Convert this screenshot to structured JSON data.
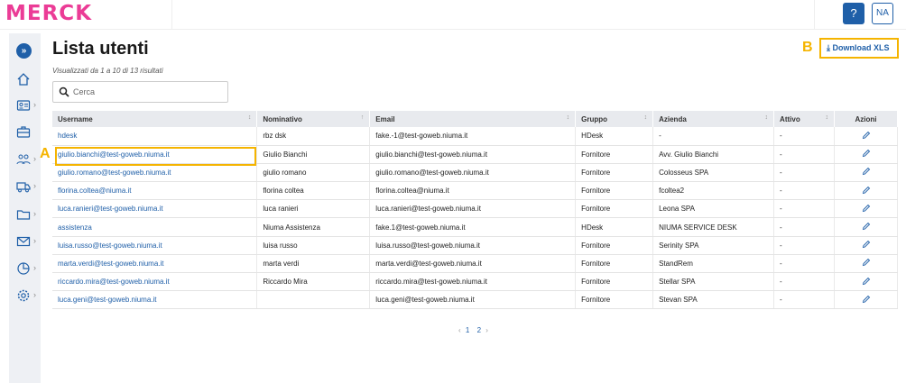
{
  "header": {
    "logo_text": "MERCK",
    "help_label": "?",
    "avatar_initials": "NA",
    "brand_color": "#eb3c96",
    "accent_color": "#1f5fa8"
  },
  "sidebar": {
    "expand_icon": "double-chevron-right-icon",
    "items": [
      {
        "name": "home",
        "icon": "home-icon",
        "has_submenu": false
      },
      {
        "name": "contacts",
        "icon": "id-card-icon",
        "has_submenu": true
      },
      {
        "name": "briefcase",
        "icon": "briefcase-icon",
        "has_submenu": false
      },
      {
        "name": "users",
        "icon": "users-icon",
        "has_submenu": true
      },
      {
        "name": "transport",
        "icon": "truck-icon",
        "has_submenu": true
      },
      {
        "name": "folder",
        "icon": "folder-icon",
        "has_submenu": true
      },
      {
        "name": "mail",
        "icon": "mail-icon",
        "has_submenu": true
      },
      {
        "name": "reports",
        "icon": "pie-chart-icon",
        "has_submenu": true
      },
      {
        "name": "settings",
        "icon": "gear-icon",
        "has_submenu": true
      }
    ]
  },
  "page": {
    "title": "Lista utenti",
    "subtitle": "Visualizzati da 1 a 10 di 13 risultati",
    "download_label": "Download XLS",
    "search_placeholder": "Cerca",
    "annotation_a": "A",
    "annotation_b": "B"
  },
  "table": {
    "columns": [
      "Username",
      "Nominativo",
      "Email",
      "Gruppo",
      "Azienda",
      "Attivo",
      "Azioni"
    ],
    "rows": [
      {
        "username": "hdesk",
        "nominativo": "rbz dsk",
        "email": "fake.-1@test-goweb.niuma.it",
        "gruppo": "HDesk",
        "azienda": "-",
        "attivo": "-"
      },
      {
        "username": "giulio.bianchi@test-goweb.niuma.it",
        "nominativo": "Giulio Bianchi",
        "email": "giulio.bianchi@test-goweb.niuma.it",
        "gruppo": "Fornitore",
        "azienda": "Avv. Giulio Bianchi",
        "attivo": "-"
      },
      {
        "username": "giulio.romano@test-goweb.niuma.it",
        "nominativo": "giulio romano",
        "email": "giulio.romano@test-goweb.niuma.it",
        "gruppo": "Fornitore",
        "azienda": "Colosseus SPA",
        "attivo": "-"
      },
      {
        "username": "florina.coltea@niuma.it",
        "nominativo": "florina coltea",
        "email": "florina.coltea@niuma.it",
        "gruppo": "Fornitore",
        "azienda": "fcoltea2",
        "attivo": "-"
      },
      {
        "username": "luca.ranieri@test-goweb.niuma.it",
        "nominativo": "luca ranieri",
        "email": "luca.ranieri@test-goweb.niuma.it",
        "gruppo": "Fornitore",
        "azienda": "Leona SPA",
        "attivo": "-"
      },
      {
        "username": "assistenza",
        "nominativo": "Niuma Assistenza",
        "email": "fake.1@test-goweb.niuma.it",
        "gruppo": "HDesk",
        "azienda": "NIUMA SERVICE DESK",
        "attivo": "-"
      },
      {
        "username": "luisa.russo@test-goweb.niuma.it",
        "nominativo": "luisa russo",
        "email": "luisa.russo@test-goweb.niuma.it",
        "gruppo": "Fornitore",
        "azienda": "Serinity SPA",
        "attivo": "-"
      },
      {
        "username": "marta.verdi@test-goweb.niuma.it",
        "nominativo": "marta verdi",
        "email": "marta.verdi@test-goweb.niuma.it",
        "gruppo": "Fornitore",
        "azienda": "StandRem",
        "attivo": "-"
      },
      {
        "username": "riccardo.mira@test-goweb.niuma.it",
        "nominativo": "Riccardo Mira",
        "email": "riccardo.mira@test-goweb.niuma.it",
        "gruppo": "Fornitore",
        "azienda": "Stellar SPA",
        "attivo": "-"
      },
      {
        "username": "luca.geni@test-goweb.niuma.it",
        "nominativo": "",
        "email": "luca.geni@test-goweb.niuma.it",
        "gruppo": "Fornitore",
        "azienda": "Stevan SPA",
        "attivo": "-"
      }
    ]
  },
  "pagination": {
    "prev": "‹",
    "pages": [
      "1",
      "2"
    ],
    "current": "1",
    "next": "›"
  }
}
